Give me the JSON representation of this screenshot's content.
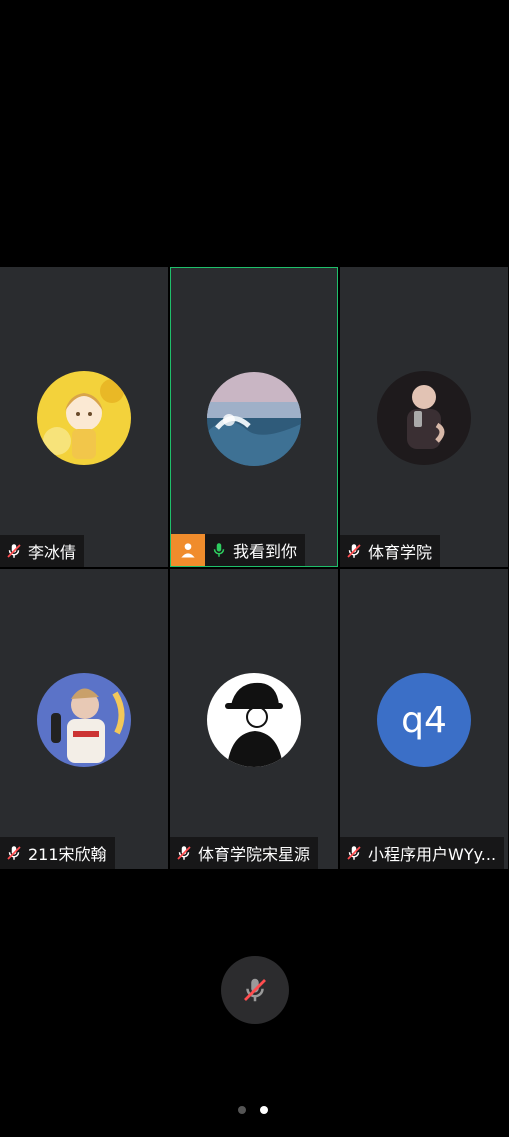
{
  "participants": [
    {
      "name": "李冰倩",
      "mic": "muted",
      "avatar": "anime-girl-yellow"
    },
    {
      "name": "我看到你",
      "mic": "active",
      "avatar": "ocean-waves",
      "host": true,
      "host_icon": "person-icon"
    },
    {
      "name": "体育学院",
      "mic": "muted",
      "avatar": "child-photo"
    },
    {
      "name": "211宋欣翰",
      "mic": "muted",
      "avatar": "cartoon-boy-blue"
    },
    {
      "name": "体育学院宋星源",
      "mic": "muted",
      "avatar": "bucket-hat-illustration"
    },
    {
      "name": "小程序用户WYy...",
      "mic": "muted",
      "avatar_initials": "q4",
      "avatar_color": "#3b6fc7"
    }
  ],
  "controls": {
    "mic_button": "muted-mic-icon"
  },
  "pagination": {
    "pages": 2,
    "current": 2
  },
  "colors": {
    "active_border": "#1fbf6b",
    "host_badge": "#f08c2c",
    "mic_on": "#2ecc5f",
    "mic_off": "#ff4d4f"
  }
}
